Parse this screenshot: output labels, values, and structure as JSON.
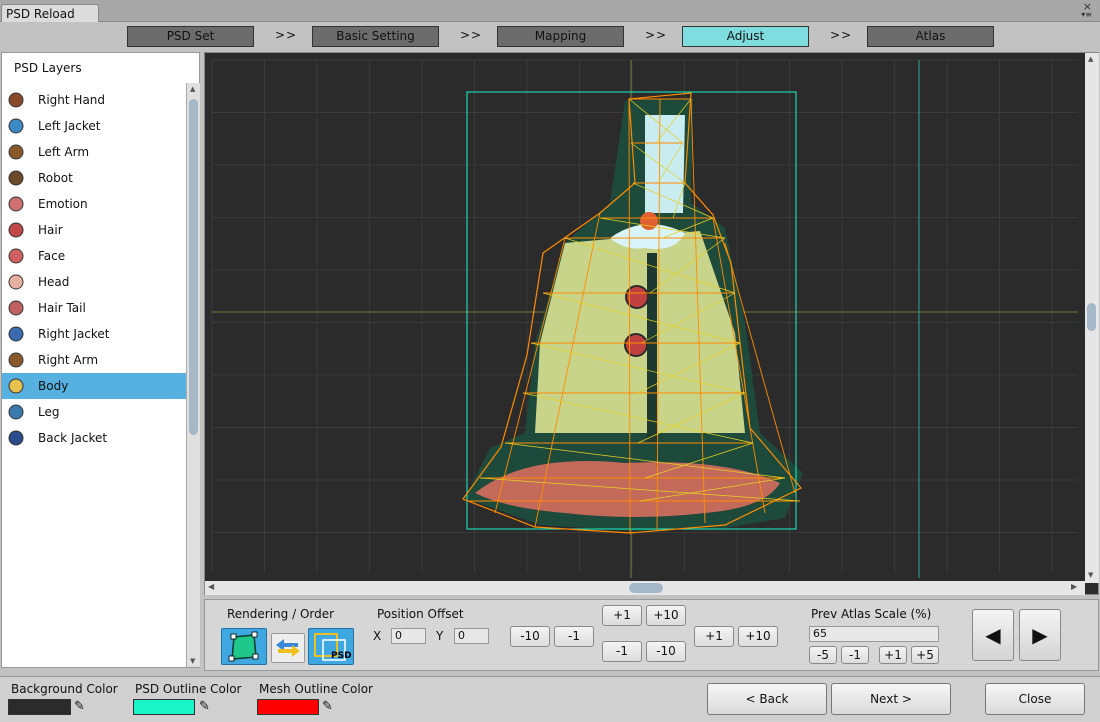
{
  "window": {
    "tab_title": "PSD Reload",
    "close_glyph": "×",
    "menu_glyph": "▾≡"
  },
  "steps": [
    {
      "label": "PSD Set",
      "active": false
    },
    {
      "label": "Basic Setting",
      "active": false
    },
    {
      "label": "Mapping",
      "active": false
    },
    {
      "label": "Adjust",
      "active": true
    },
    {
      "label": "Atlas",
      "active": false
    }
  ],
  "step_separator": ">>",
  "layers_panel": {
    "title": "PSD Layers",
    "items": [
      {
        "label": "Right Hand",
        "icon": "right-hand-icon",
        "selected": false
      },
      {
        "label": "Left Jacket",
        "icon": "left-jacket-icon",
        "selected": false
      },
      {
        "label": "Left Arm",
        "icon": "left-arm-icon",
        "selected": false
      },
      {
        "label": "Robot",
        "icon": "robot-icon",
        "selected": false
      },
      {
        "label": "Emotion",
        "icon": "emotion-icon",
        "selected": false
      },
      {
        "label": "Hair",
        "icon": "hair-icon",
        "selected": false
      },
      {
        "label": "Face",
        "icon": "face-icon",
        "selected": false
      },
      {
        "label": "Head",
        "icon": "head-icon",
        "selected": false
      },
      {
        "label": "Hair Tail",
        "icon": "hair-tail-icon",
        "selected": false
      },
      {
        "label": "Right Jacket",
        "icon": "right-jacket-icon",
        "selected": false
      },
      {
        "label": "Right Arm",
        "icon": "right-arm-icon",
        "selected": false
      },
      {
        "label": "Body",
        "icon": "body-icon",
        "selected": true
      },
      {
        "label": "Leg",
        "icon": "leg-icon",
        "selected": false
      },
      {
        "label": "Back Jacket",
        "icon": "back-jacket-icon",
        "selected": false
      }
    ]
  },
  "controls": {
    "rendering_label": "Rendering / Order",
    "psd_badge": "PSD",
    "position_offset_label": "Position Offset",
    "x_label": "X",
    "x_value": "0",
    "y_label": "Y",
    "y_value": "0",
    "x_minus10": "-10",
    "x_minus1": "-1",
    "y_plus1": "+1",
    "y_plus10": "+10",
    "y_minus1": "-1",
    "y_minus10": "-10",
    "x_plus1": "+1",
    "x_plus10": "+10",
    "atlas_scale_label": "Prev Atlas Scale (%)",
    "atlas_scale_value": "65",
    "scale_minus5": "-5",
    "scale_minus1": "-1",
    "scale_plus1": "+1",
    "scale_plus5": "+5",
    "prev_glyph": "◀",
    "next_glyph": "▶"
  },
  "bottom": {
    "background_color_label": "Background Color",
    "background_color": "#2b2b2b",
    "psd_outline_color_label": "PSD Outline Color",
    "psd_outline_color": "#1af5c8",
    "mesh_outline_color_label": "Mesh Outline Color",
    "mesh_outline_color": "#ff0000",
    "back_label": "< Back",
    "next_label": "Next >",
    "close_label": "Close"
  },
  "colors": {
    "accent": "#7fdde0",
    "selection": "#56b0e0",
    "mesh": "#ff8c00",
    "psd_outline": "#1af5c8"
  }
}
